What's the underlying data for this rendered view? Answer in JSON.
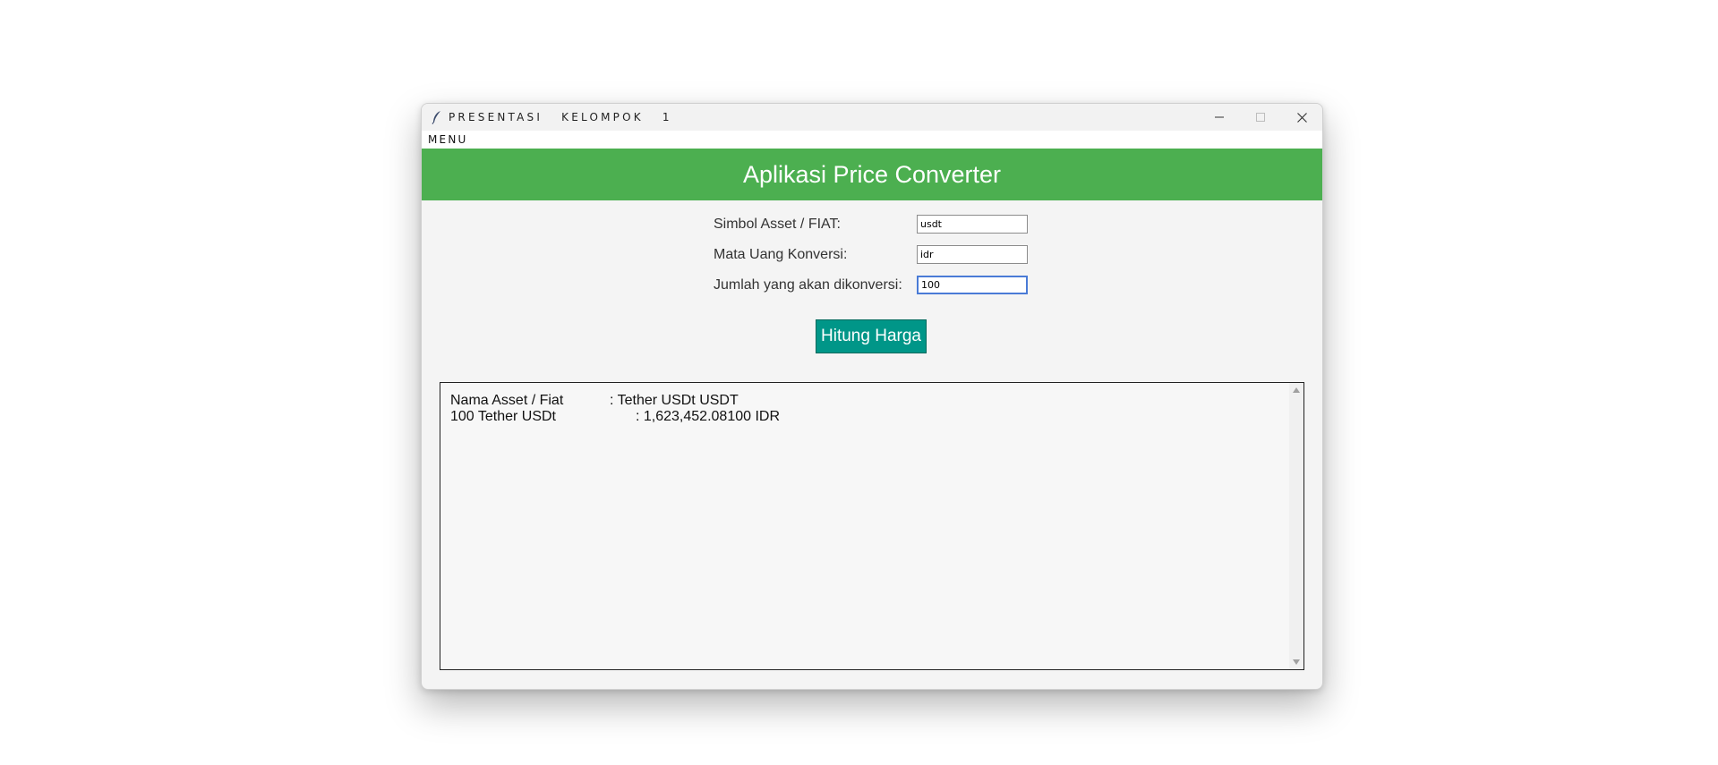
{
  "window": {
    "title": "PRESENTASI   KELOMPOK   1"
  },
  "menubar": {
    "items": [
      "MENU"
    ]
  },
  "header": {
    "title": "Aplikasi Price Converter"
  },
  "form": {
    "symbol_label": "Simbol Asset / FIAT:",
    "symbol_value": "usdt",
    "currency_label": "Mata Uang Konversi:",
    "currency_value": "idr",
    "amount_label": "Jumlah yang akan dikonversi:",
    "amount_value": "100"
  },
  "button": {
    "calculate_label": "Hitung Harga"
  },
  "result": {
    "line1_key": "Nama Asset / Fiat",
    "line1_value": ": Tether USDt USDT",
    "line2_key": "100 Tether USDt",
    "line2_value": ": 1,623,452.08100 IDR"
  },
  "colors": {
    "header_bg": "#4caf50",
    "button_bg": "#009688"
  }
}
